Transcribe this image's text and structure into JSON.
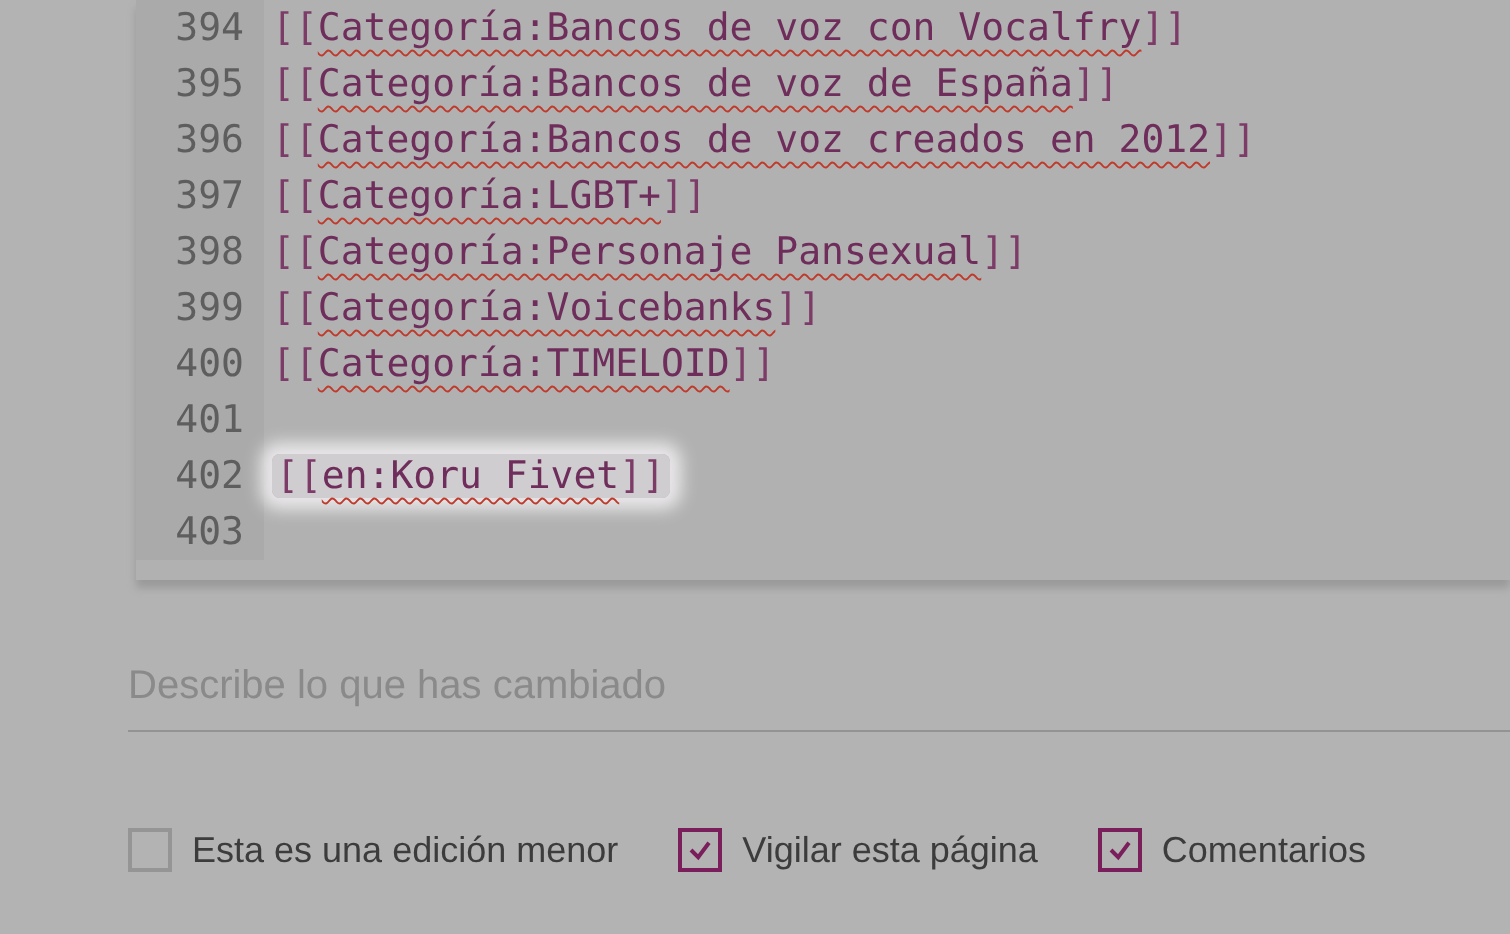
{
  "editor": {
    "lines": [
      {
        "number": "394",
        "open": "[[",
        "link": "Categoría:Bancos de voz con Vocalfry",
        "close": "]]",
        "highlighted": false
      },
      {
        "number": "395",
        "open": "[[",
        "link": "Categoría:Bancos de voz de España",
        "close": "]]",
        "highlighted": false
      },
      {
        "number": "396",
        "open": "[[",
        "link": "Categoría:Bancos de voz creados en 2012",
        "close": "]]",
        "highlighted": false
      },
      {
        "number": "397",
        "open": "[[",
        "link": "Categoría:LGBT+",
        "close": "]]",
        "highlighted": false
      },
      {
        "number": "398",
        "open": "[[",
        "link": "Categoría:Personaje Pansexual",
        "close": "]]",
        "highlighted": false
      },
      {
        "number": "399",
        "open": "[[",
        "link": "Categoría:Voicebanks",
        "close": "]]",
        "highlighted": false
      },
      {
        "number": "400",
        "open": "[[",
        "link": "Categoría:TIMELOID",
        "close": "]]",
        "highlighted": false
      },
      {
        "number": "401"
      },
      {
        "number": "402",
        "open": "[[",
        "link": "en:Koru Fivet",
        "close": "]]",
        "highlighted": true
      },
      {
        "number": "403"
      }
    ]
  },
  "summary": {
    "placeholder": "Describe lo que has cambiado"
  },
  "options": [
    {
      "label": "Esta es una edición menor",
      "checked": false
    },
    {
      "label": "Vigilar esta página",
      "checked": true
    },
    {
      "label": "Comentarios",
      "checked": true
    }
  ]
}
